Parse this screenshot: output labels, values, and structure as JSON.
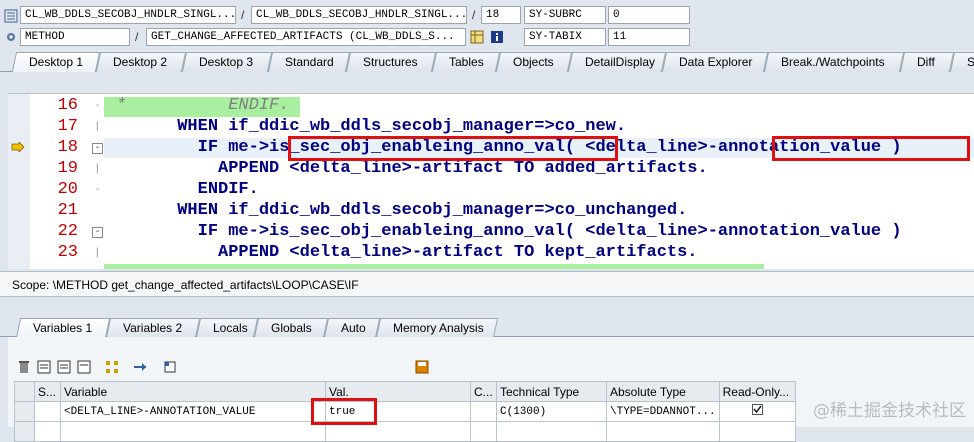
{
  "toolbar": {
    "program_1": "CL_WB_DDLS_SECOBJ_HNDLR_SINGL...",
    "program_2": "CL_WB_DDLS_SECOBJ_HNDLR_SINGL...",
    "line_no": "18",
    "sy_subrc_label": "SY-SUBRC",
    "sy_subrc_value": "0",
    "event_type": "METHOD",
    "event_name": "GET_CHANGE_AFFECTED_ARTIFACTS (CL_WB_DDLS_S...",
    "sy_tabix_label": "SY-TABIX",
    "sy_tabix_value": "11",
    "slash": "/"
  },
  "main_tabs": [
    "Desktop 1",
    "Desktop 2",
    "Desktop 3",
    "Standard",
    "Structures",
    "Tables",
    "Objects",
    "DetailDisplay",
    "Data Explorer",
    "Break./Watchpoints",
    "Diff",
    "Sc"
  ],
  "code": {
    "lines": [
      {
        "no": "16",
        "text": "*          ENDIF."
      },
      {
        "no": "17",
        "text": "      WHEN if_ddic_wb_ddls_secobj_manager=>co_new."
      },
      {
        "no": "18",
        "text": "        IF me->is_sec_obj_enableing_anno_val( <delta_line>-annotation_value )"
      },
      {
        "no": "19",
        "text": "          APPEND <delta_line>-artifact TO added_artifacts."
      },
      {
        "no": "20",
        "text": "        ENDIF."
      },
      {
        "no": "21",
        "text": "      WHEN if_ddic_wb_ddls_secobj_manager=>co_unchanged."
      },
      {
        "no": "22",
        "text": "        IF me->is_sec_obj_enableing_anno_val( <delta_line>-annotation_value )"
      },
      {
        "no": "23",
        "text": "          APPEND <delta_line>-artifact TO kept_artifacts."
      }
    ]
  },
  "scope": "Scope: \\METHOD get_change_affected_artifacts\\LOOP\\CASE\\IF",
  "var_tabs": [
    "Variables 1",
    "Variables 2",
    "Locals",
    "Globals",
    "Auto",
    "Memory Analysis"
  ],
  "vars_table": {
    "headers": [
      "S...",
      "Variable",
      "Val.",
      "C...",
      "Technical Type",
      "Absolute Type",
      "Read-Only..."
    ],
    "row": {
      "variable": "<DELTA_LINE>-ANNOTATION_VALUE",
      "value": "true",
      "technical_type": "C(1300)",
      "absolute_type": "\\TYPE=DDANNOT..."
    }
  },
  "watermark": "@稀土掘金技术社区",
  "colors": {
    "highlight": "#e01010",
    "comment_bg": "#a8f0a0",
    "line_no": "#c00000",
    "keyword": "#000080"
  }
}
